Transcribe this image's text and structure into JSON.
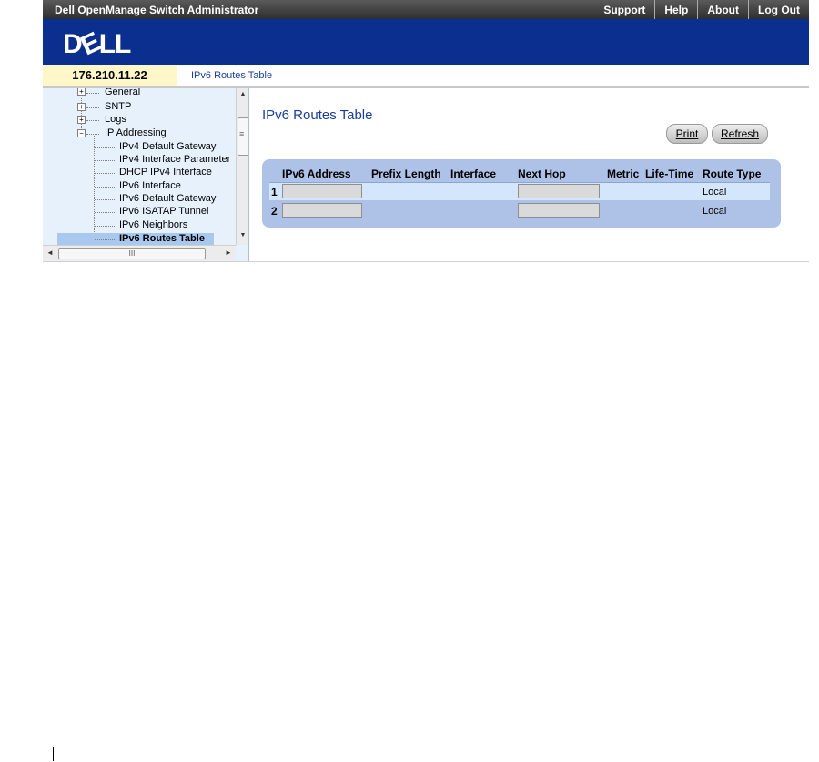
{
  "app": {
    "title": "Dell OpenManage Switch Administrator",
    "nav": [
      "Support",
      "Help",
      "About",
      "Log Out"
    ],
    "logo": {
      "d": "D",
      "e": "E",
      "ll": "LL"
    },
    "ip": "176.210.11.22",
    "breadcrumb": "IPv6 Routes Table"
  },
  "sidebar": {
    "items": [
      {
        "label": "General",
        "expander": "+"
      },
      {
        "label": "SNTP",
        "expander": "+"
      },
      {
        "label": "Logs",
        "expander": "+"
      },
      {
        "label": "IP Addressing",
        "expander": "−"
      },
      {
        "label": "IPv4 Default Gateway"
      },
      {
        "label": "IPv4 Interface Parameter"
      },
      {
        "label": "DHCP IPv4 Interface"
      },
      {
        "label": "IPv6 Interface"
      },
      {
        "label": "IPv6 Default Gateway"
      },
      {
        "label": "IPv6 ISATAP Tunnel"
      },
      {
        "label": "IPv6 Neighbors"
      },
      {
        "label": "IPv6 Routes Table"
      }
    ],
    "scroll": {
      "up": "▲",
      "down": "▼",
      "left": "◄",
      "right": "►",
      "grip_v": "≡",
      "grip_h": "III"
    }
  },
  "main": {
    "title": "IPv6 Routes Table",
    "buttons": {
      "print": "Print",
      "refresh": "Refresh"
    },
    "table": {
      "headers": [
        "IPv6 Address",
        "Prefix Length",
        "Interface",
        "Next Hop",
        "Metric",
        "Life-Time",
        "Route Type"
      ],
      "rows": [
        {
          "num": "1",
          "ipv6_address": "",
          "next_hop": "",
          "route_type": "Local"
        },
        {
          "num": "2",
          "ipv6_address": "",
          "next_hop": "",
          "route_type": "Local"
        }
      ]
    }
  }
}
